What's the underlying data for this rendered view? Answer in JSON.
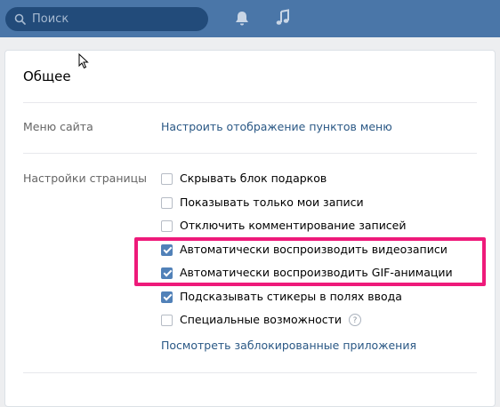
{
  "header": {
    "search_placeholder": "Поиск",
    "icons": [
      "search-icon",
      "bell-icon",
      "music-icon"
    ],
    "colors": {
      "bar": "#4a76a8",
      "search_bg": "#224b7a"
    }
  },
  "panel": {
    "title": "Общее",
    "site_menu": {
      "label": "Меню сайта",
      "link": "Настроить отображение пунктов меню"
    },
    "page_settings": {
      "label": "Настройки страницы",
      "options": [
        {
          "label": "Скрывать блок подарков",
          "checked": false
        },
        {
          "label": "Показывать только мои записи",
          "checked": false
        },
        {
          "label": "Отключить комментирование записей",
          "checked": false
        },
        {
          "label": "Автоматически воспроизводить видеозаписи",
          "checked": true
        },
        {
          "label": "Автоматически воспроизводить GIF-анимации",
          "checked": true
        },
        {
          "label": "Подсказывать стикеры в полях ввода",
          "checked": true
        },
        {
          "label": "Специальные возможности",
          "checked": false,
          "help": "?"
        }
      ],
      "blocked_apps_link": "Посмотреть заблокированные приложения"
    }
  },
  "colors": {
    "accent": "#5181b8",
    "link": "#2a5885",
    "highlight": "#ee1a7a"
  }
}
